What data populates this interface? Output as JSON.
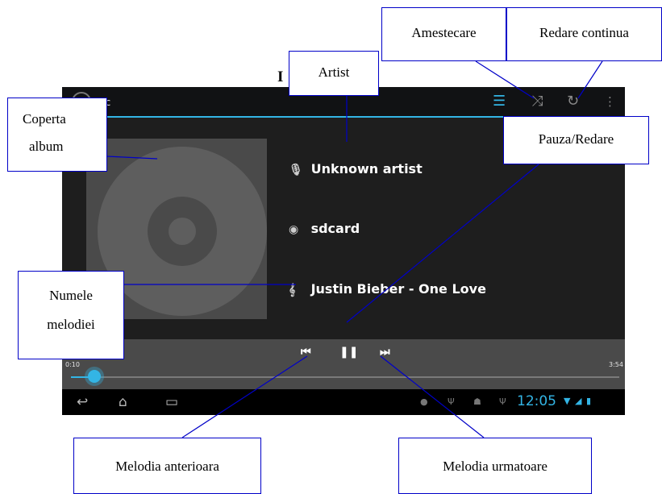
{
  "heading": "I",
  "app": {
    "title": "sic"
  },
  "action_icons": {
    "list": "list-icon",
    "shuffle": "shuffle-icon",
    "repeat": "repeat-icon",
    "overflow": "overflow-menu-icon"
  },
  "track_info": {
    "artist": "Unknown artist",
    "album": "sdcard",
    "title": "Justin Bieber - One Love"
  },
  "player": {
    "elapsed": "0:10",
    "duration": "3:54",
    "progress": 0.043
  },
  "status_bar": {
    "clock": "12:05"
  },
  "callouts": {
    "shuffle": "Amestecare",
    "repeat": "Redare continua",
    "artist": "Artist",
    "cover": [
      "Coperta",
      "album"
    ],
    "pause_play": "Pauza/Redare",
    "song_name": [
      "Numele",
      "melodiei"
    ],
    "previous": "Melodia anterioara",
    "next": "Melodia urmatoare"
  },
  "colors": {
    "accent": "#33b5e5",
    "callout_border": "#0000c8"
  }
}
